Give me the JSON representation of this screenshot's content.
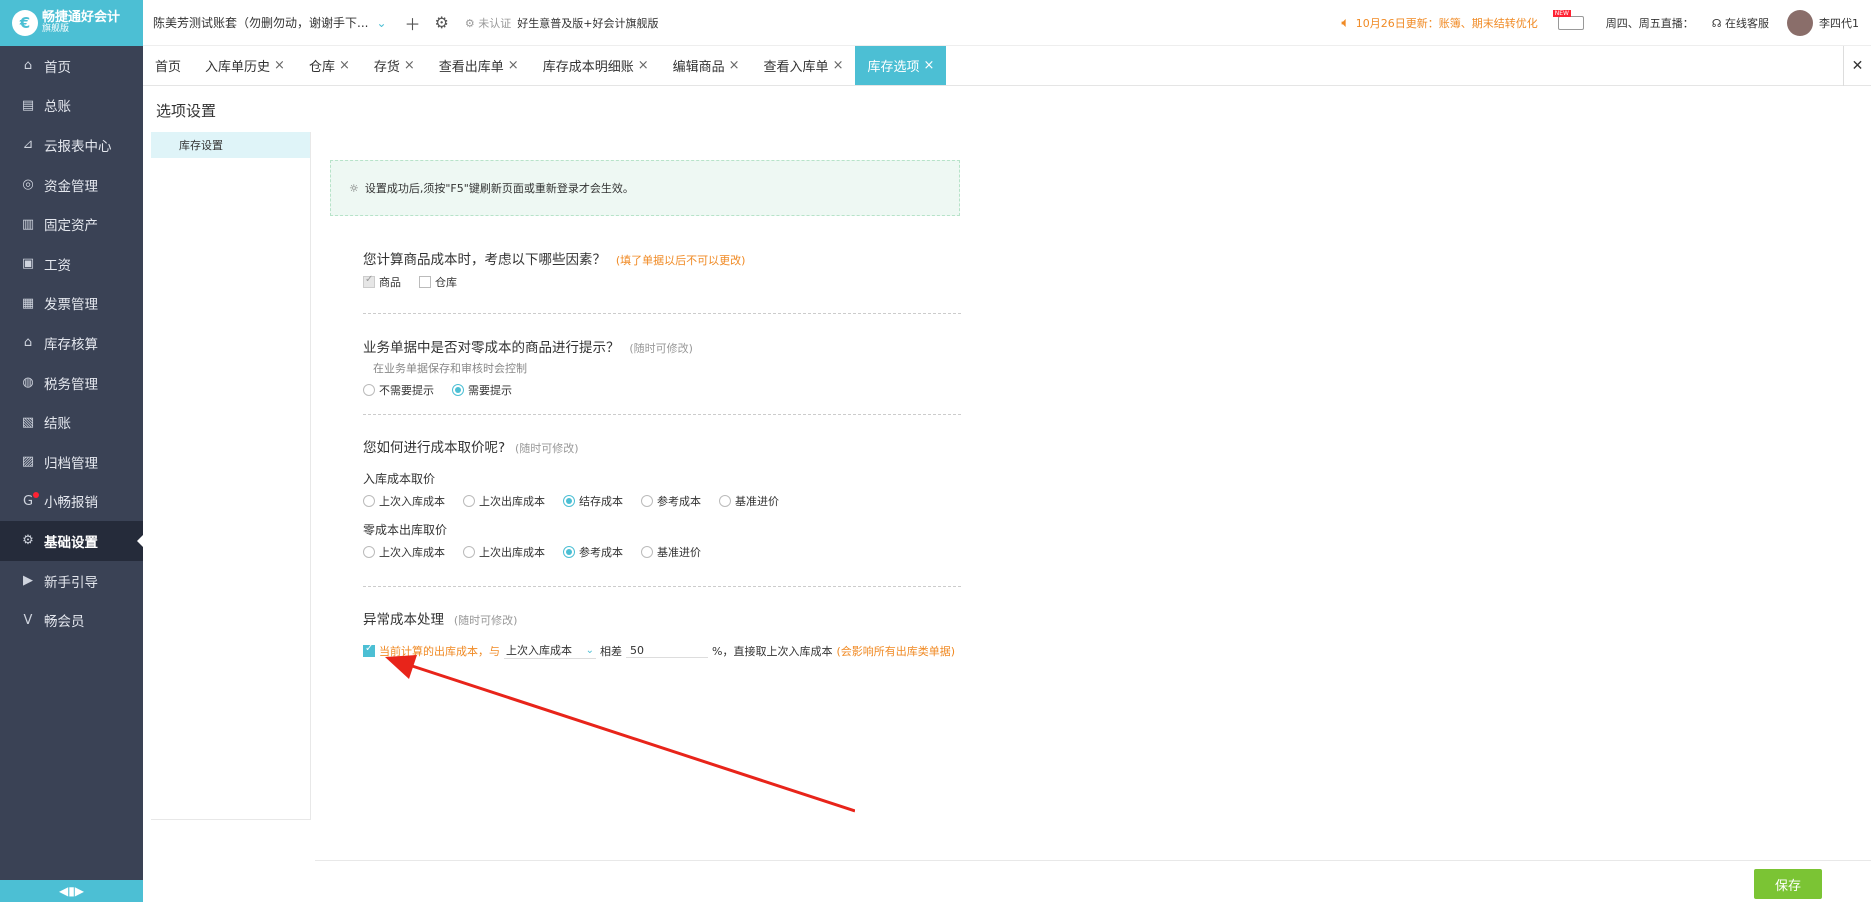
{
  "brand": {
    "name": "畅捷通好会计",
    "sub": "旗舰版"
  },
  "sidebar": {
    "items": [
      {
        "label": "首页",
        "icon": "home-icon",
        "glyph": "⌂"
      },
      {
        "label": "总账",
        "icon": "ledger-icon",
        "glyph": "▤"
      },
      {
        "label": "云报表中心",
        "icon": "chart-icon",
        "glyph": "⊿"
      },
      {
        "label": "资金管理",
        "icon": "money-bag-icon",
        "glyph": "◎"
      },
      {
        "label": "固定资产",
        "icon": "building-icon",
        "glyph": "▥"
      },
      {
        "label": "工资",
        "icon": "salary-icon",
        "glyph": "▣"
      },
      {
        "label": "发票管理",
        "icon": "invoice-icon",
        "glyph": "▦"
      },
      {
        "label": "库存核算",
        "icon": "warehouse-icon",
        "glyph": "⌂"
      },
      {
        "label": "税务管理",
        "icon": "tax-icon",
        "glyph": "◍"
      },
      {
        "label": "结账",
        "icon": "checkout-icon",
        "glyph": "▧"
      },
      {
        "label": "归档管理",
        "icon": "archive-icon",
        "glyph": "▨"
      },
      {
        "label": "小畅报销",
        "icon": "reimburse-icon",
        "glyph": "G"
      },
      {
        "label": "基础设置",
        "icon": "gear-icon",
        "glyph": "⚙"
      },
      {
        "label": "新手引导",
        "icon": "guide-icon",
        "glyph": "▶"
      },
      {
        "label": "畅会员",
        "icon": "vip-icon",
        "glyph": "V"
      }
    ]
  },
  "topbar": {
    "account": "陈美芳测试账套（勿删勿动，谢谢手下...",
    "cert": "未认证",
    "promo": "好生意普及版+好会计旗舰版",
    "update": "10月26日更新：账簿、期末结转优化",
    "live": "周四、周五直播：",
    "service": "在线客服",
    "user": "李四代1"
  },
  "tabs": [
    {
      "label": "首页",
      "closable": false
    },
    {
      "label": "入库单历史",
      "closable": true
    },
    {
      "label": "仓库",
      "closable": true
    },
    {
      "label": "存货",
      "closable": true
    },
    {
      "label": "查看出库单",
      "closable": true
    },
    {
      "label": "库存成本明细账",
      "closable": true
    },
    {
      "label": "编辑商品",
      "closable": true
    },
    {
      "label": "查看入库单",
      "closable": true
    },
    {
      "label": "库存选项",
      "closable": true
    }
  ],
  "page": {
    "title": "选项设置",
    "left_item": "库存设置"
  },
  "tip": "设置成功后,须按\"F5\"键刷新页面或重新登录才会生效。",
  "sections": {
    "s1": {
      "question": "您计算商品成本时，考虑以下哪些因素？",
      "note": "(填了单据以后不可以更改)",
      "opt1": "商品",
      "opt2": "仓库"
    },
    "s2": {
      "question": "业务单据中是否对零成本的商品进行提示？",
      "note": "(随时可修改)",
      "sub": "在业务单据保存和审核时会控制",
      "opt1": "不需要提示",
      "opt2": "需要提示"
    },
    "s3": {
      "question": "您如何进行成本取价呢?",
      "note": "(随时可修改)",
      "in_label": "入库成本取价",
      "in_opts": [
        "上次入库成本",
        "上次出库成本",
        "结存成本",
        "参考成本",
        "基准进价"
      ],
      "zero_label": "零成本出库取价",
      "zero_opts": [
        "上次入库成本",
        "上次出库成本",
        "参考成本",
        "基准进价"
      ]
    },
    "s4": {
      "question": "异常成本处理",
      "note": "(随时可修改)",
      "text1": "当前计算的出库成本，与",
      "select": "上次入库成本",
      "text2": "相差",
      "value": "50",
      "text3": "%，直接取上次入库成本",
      "note2": "(会影响所有出库类单据)"
    }
  },
  "save_label": "保存",
  "colors": {
    "accent": "#4cbfd4",
    "sidebar": "#3a4255",
    "save": "#7bc434",
    "arrow": "#e8241a",
    "warning": "#f08a24"
  }
}
